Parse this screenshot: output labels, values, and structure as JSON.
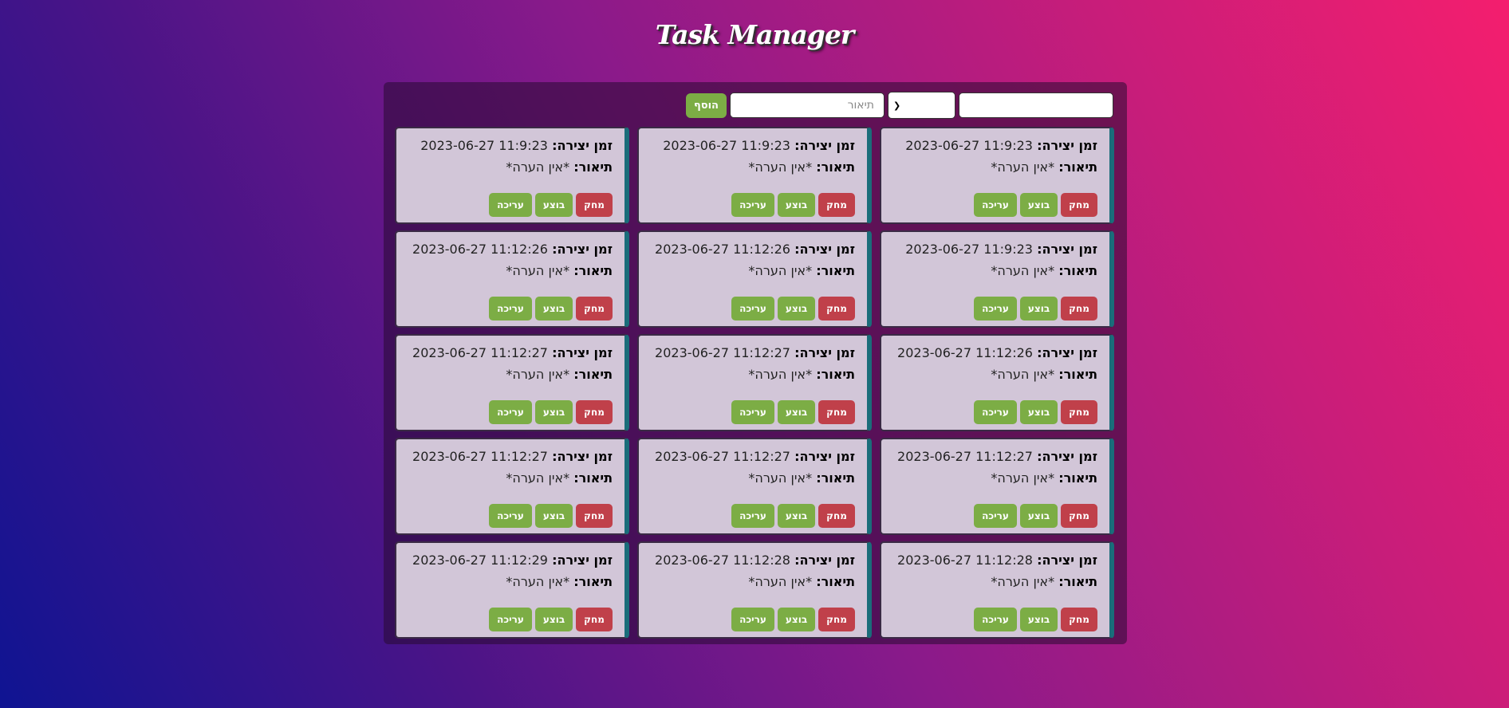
{
  "app": {
    "title": "Task Manager"
  },
  "toolbar": {
    "name_value": "",
    "priority_value": "",
    "description_placeholder": "תיאור",
    "add_label": "הוסף"
  },
  "labels": {
    "created": "זמן יצירה:",
    "description": "תיאור:",
    "delete": "מחק",
    "done": "בוצע",
    "edit": "עריכה"
  },
  "colors": {
    "accent_green": "#7cad45",
    "danger_red": "#c0404a",
    "card_stripe": "#1a6d7a"
  },
  "tasks": [
    {
      "created": "2023-06-27 11:9:23",
      "description": "*אין הערה*"
    },
    {
      "created": "2023-06-27 11:9:23",
      "description": "*אין הערה*"
    },
    {
      "created": "2023-06-27 11:9:23",
      "description": "*אין הערה*"
    },
    {
      "created": "2023-06-27 11:9:23",
      "description": "*אין הערה*"
    },
    {
      "created": "2023-06-27 11:12:26",
      "description": "*אין הערה*"
    },
    {
      "created": "2023-06-27 11:12:26",
      "description": "*אין הערה*"
    },
    {
      "created": "2023-06-27 11:12:26",
      "description": "*אין הערה*"
    },
    {
      "created": "2023-06-27 11:12:27",
      "description": "*אין הערה*"
    },
    {
      "created": "2023-06-27 11:12:27",
      "description": "*אין הערה*"
    },
    {
      "created": "2023-06-27 11:12:27",
      "description": "*אין הערה*"
    },
    {
      "created": "2023-06-27 11:12:27",
      "description": "*אין הערה*"
    },
    {
      "created": "2023-06-27 11:12:27",
      "description": "*אין הערה*"
    },
    {
      "created": "2023-06-27 11:12:28",
      "description": "*אין הערה*"
    },
    {
      "created": "2023-06-27 11:12:28",
      "description": "*אין הערה*"
    },
    {
      "created": "2023-06-27 11:12:29",
      "description": "*אין הערה*"
    }
  ]
}
